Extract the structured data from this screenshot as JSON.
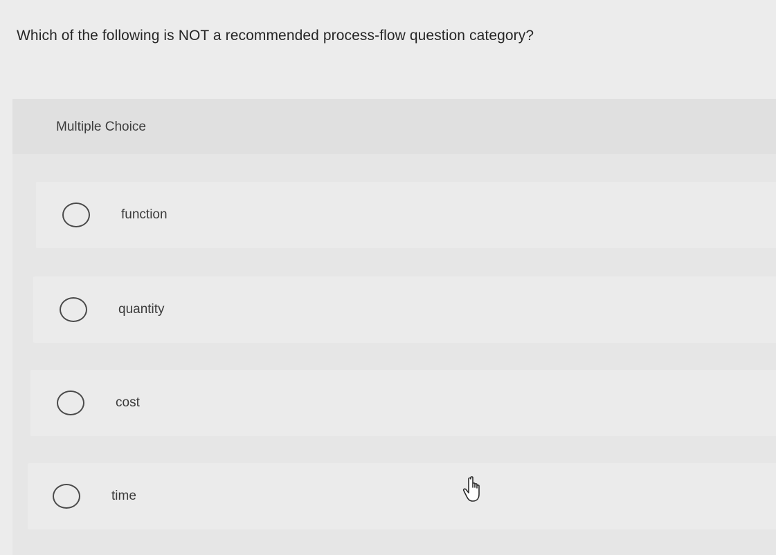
{
  "question": {
    "text": "Which of the following is NOT a recommended process-flow question category?"
  },
  "panel": {
    "title": "Multiple Choice"
  },
  "options": [
    {
      "label": "function",
      "selected": false
    },
    {
      "label": "quantity",
      "selected": false
    },
    {
      "label": "cost",
      "selected": false
    },
    {
      "label": "time",
      "selected": false
    }
  ],
  "cursor": {
    "icon": "hand-pointer-icon"
  }
}
